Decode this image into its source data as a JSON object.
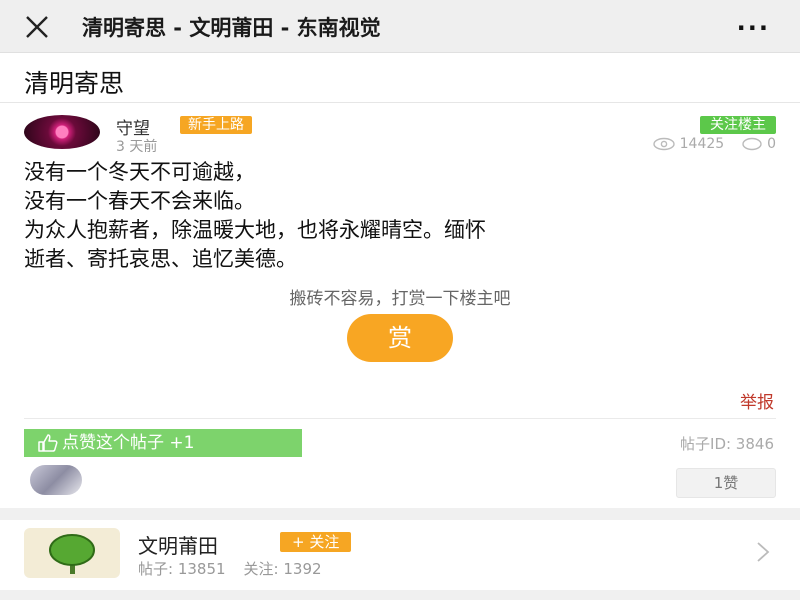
{
  "topbar": {
    "title": "清明寄思 - 文明莆田 - 东南视觉",
    "close_icon": "close-icon",
    "more_label": "···"
  },
  "page": {
    "title": "清明寄思"
  },
  "post": {
    "author": "守望",
    "author_badge": "新手上路",
    "time": "3 天前",
    "follow_owner_label": "关注楼主",
    "views": "14425",
    "comments": "0",
    "lines": [
      "没有一个冬天不可逾越，",
      "没有一个春天不会来临。",
      "为众人抱薪者，除温暖大地，也将永耀晴空。缅怀",
      "逝者、寄托哀思、追忆美德。"
    ],
    "reward_hint": "搬砖不容易，打赏一下楼主吧",
    "reward_label": "赏",
    "report_label": "举报",
    "like_label": "点赞这个帖子 +1",
    "post_id": "帖子ID: 3846",
    "likes_label": "1赞"
  },
  "channel": {
    "name": "文明莆田",
    "follow_label": "+ 关注",
    "posts": "帖子: 13851",
    "followers": "关注: 1392"
  },
  "colors": {
    "accent_orange": "#f6a623",
    "accent_green": "#5cc84a",
    "report_red": "#c0392b"
  }
}
